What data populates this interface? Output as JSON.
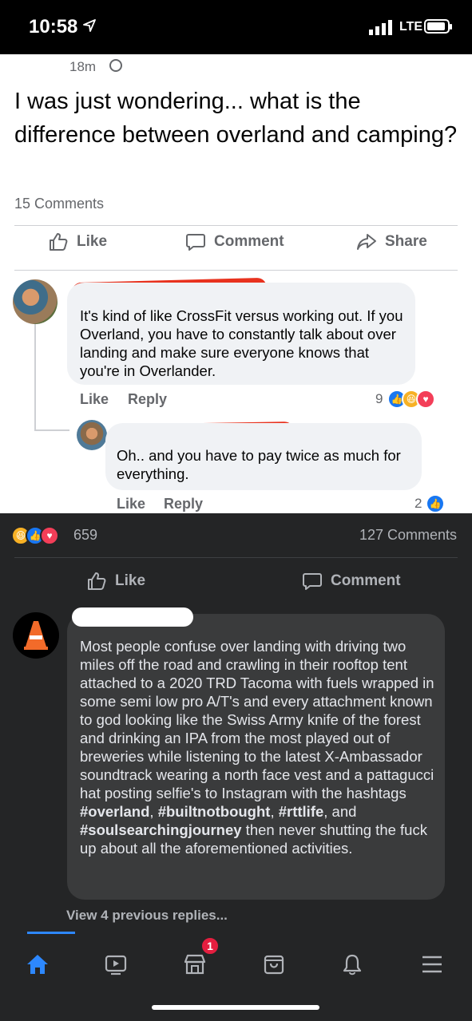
{
  "status_bar": {
    "time": "10:58",
    "network": "LTE"
  },
  "post": {
    "time": "18m",
    "text": "I was just wondering... what is the difference between overland and camping?",
    "comments_count": "15 Comments"
  },
  "post_actions": {
    "like": "Like",
    "comment": "Comment",
    "share": "Share"
  },
  "comment1": {
    "text": "It's kind of like CrossFit versus working out. If you Overland, you have to constantly talk about over landing and make sure everyone knows that you're in Overlander.",
    "like": "Like",
    "reply": "Reply",
    "reaction_count": "9"
  },
  "comment2": {
    "text": "Oh.. and you have to pay twice as much for everything.",
    "like": "Like",
    "reply": "Reply",
    "reaction_count": "2"
  },
  "outer_post": {
    "reaction_count": "659",
    "comments_count": "127 Comments",
    "like": "Like",
    "comment": "Comment"
  },
  "comment3": {
    "text_1": "Most people confuse over landing with driving two miles off the road and crawling in their rooftop tent attached to a 2020 TRD Tacoma with fuels wrapped in some semi low pro A/T's and every attachment known to god looking like the Swiss Army knife of the forest and drinking an IPA from the most played out of breweries while listening to the latest X-Ambassador soundtrack wearing a north face vest and a pattagucci hat posting selfie's to Instagram with the hashtags ",
    "tag_1": "#overland",
    "sep_1": ", ",
    "tag_2": "#builtnotbought",
    "sep_2": ", ",
    "tag_3": "#rttlife",
    "sep_3": ", and ",
    "tag_4": "#soulsearchingjourney",
    "text_2": " then never shutting the fuck up about all the aforementioned activities."
  },
  "view_previous": "View 4 previous replies...",
  "tabbar": {
    "notification_badge": "1"
  },
  "colors": {
    "accent": "#2d88ff",
    "redaction": "#e8321e",
    "badge": "#e41e3f"
  },
  "icons": [
    "location-arrow-icon",
    "signal-icon",
    "battery-icon",
    "globe-icon",
    "like-icon",
    "comment-icon",
    "share-icon",
    "like-reaction-icon",
    "haha-reaction-icon",
    "love-reaction-icon",
    "home-icon",
    "watch-icon",
    "marketplace-icon",
    "shop-icon",
    "bell-icon",
    "menu-icon"
  ]
}
